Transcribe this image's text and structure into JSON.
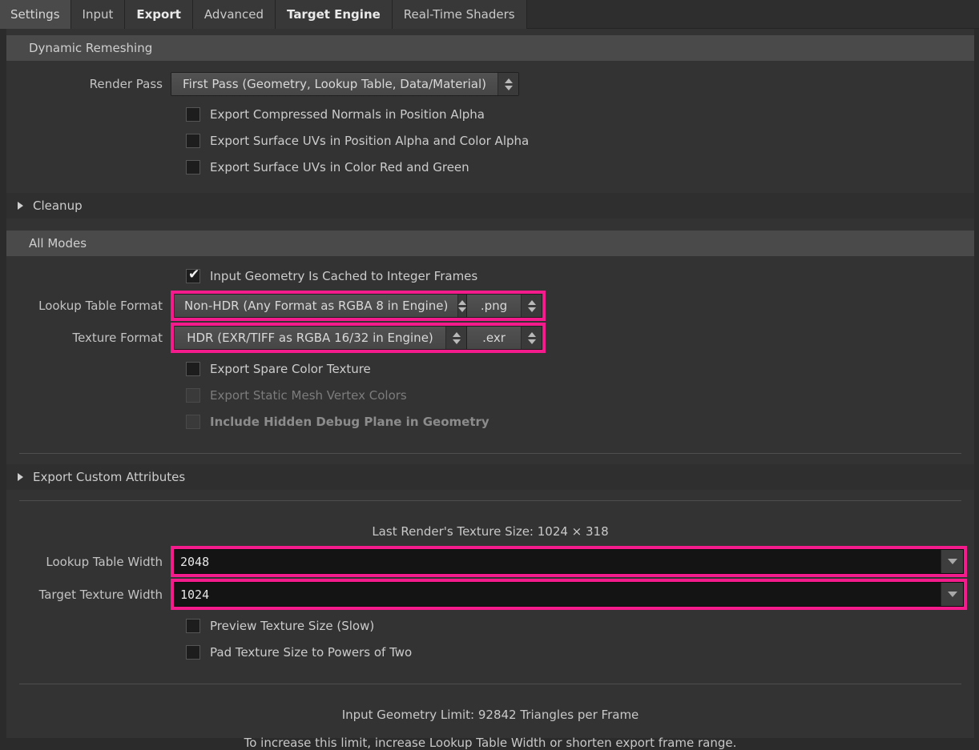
{
  "tabs": [
    {
      "label": "Settings",
      "style": "root"
    },
    {
      "label": "Input",
      "style": "normal"
    },
    {
      "label": "Export",
      "style": "bold"
    },
    {
      "label": "Advanced",
      "style": "normal"
    },
    {
      "label": "Target Engine",
      "style": "bold"
    },
    {
      "label": "Real-Time Shaders",
      "style": "normal"
    }
  ],
  "colors": {
    "highlight": "#f41c8c",
    "panel_bg": "#333333",
    "header_bg": "#4a4a4a",
    "collapsed_header_bg": "#2f2f2f"
  },
  "sections": {
    "dynamic_remeshing": {
      "title": "Dynamic Remeshing",
      "render_pass": {
        "label": "Render Pass",
        "value": "First Pass (Geometry, Lookup Table, Data/Material)"
      },
      "checkboxes": [
        {
          "label": "Export Compressed Normals in Position Alpha",
          "checked": false,
          "disabled": false
        },
        {
          "label": "Export Surface UVs in Position Alpha and Color Alpha",
          "checked": false,
          "disabled": false
        },
        {
          "label": "Export Surface UVs in Color Red and Green",
          "checked": false,
          "disabled": false
        }
      ]
    },
    "cleanup": {
      "title": "Cleanup"
    },
    "all_modes": {
      "title": "All Modes",
      "cached_checkbox": {
        "label": "Input Geometry Is Cached to Integer Frames",
        "checked": true
      },
      "lookup_table_format": {
        "label": "Lookup Table Format",
        "value": "Non-HDR (Any Format as RGBA 8 in Engine)",
        "extension": ".png"
      },
      "texture_format": {
        "label": "Texture Format",
        "value": "HDR (EXR/TIFF as RGBA 16/32 in Engine)",
        "extension": ".exr"
      },
      "checkboxes": [
        {
          "label": "Export Spare Color Texture",
          "checked": false,
          "disabled": false,
          "bold": false
        },
        {
          "label": "Export Static Mesh Vertex Colors",
          "checked": false,
          "disabled": true,
          "bold": false
        },
        {
          "label": "Include Hidden Debug Plane in Geometry",
          "checked": false,
          "disabled": true,
          "bold": true
        }
      ]
    },
    "export_custom_attributes": {
      "title": "Export Custom Attributes"
    },
    "texture_size": {
      "last_render": "Last Render's Texture Size: 1024 × 318",
      "lookup_table_width": {
        "label": "Lookup Table Width",
        "value": "2048"
      },
      "target_texture_width": {
        "label": "Target Texture Width",
        "value": "1024"
      },
      "checkboxes": [
        {
          "label": "Preview Texture Size (Slow)",
          "checked": false
        },
        {
          "label": "Pad Texture Size to Powers of Two",
          "checked": false
        }
      ]
    },
    "footer": {
      "limit": "Input Geometry Limit: 92842 Triangles per Frame",
      "hint": "To increase this limit, increase Lookup Table Width or shorten export frame range."
    }
  },
  "icons": {
    "spinner_up": "spinner-up-icon",
    "spinner_down": "spinner-down-icon",
    "disclosure": "disclosure-triangle-icon",
    "dropdown": "chevron-down-icon",
    "check": "✔"
  }
}
